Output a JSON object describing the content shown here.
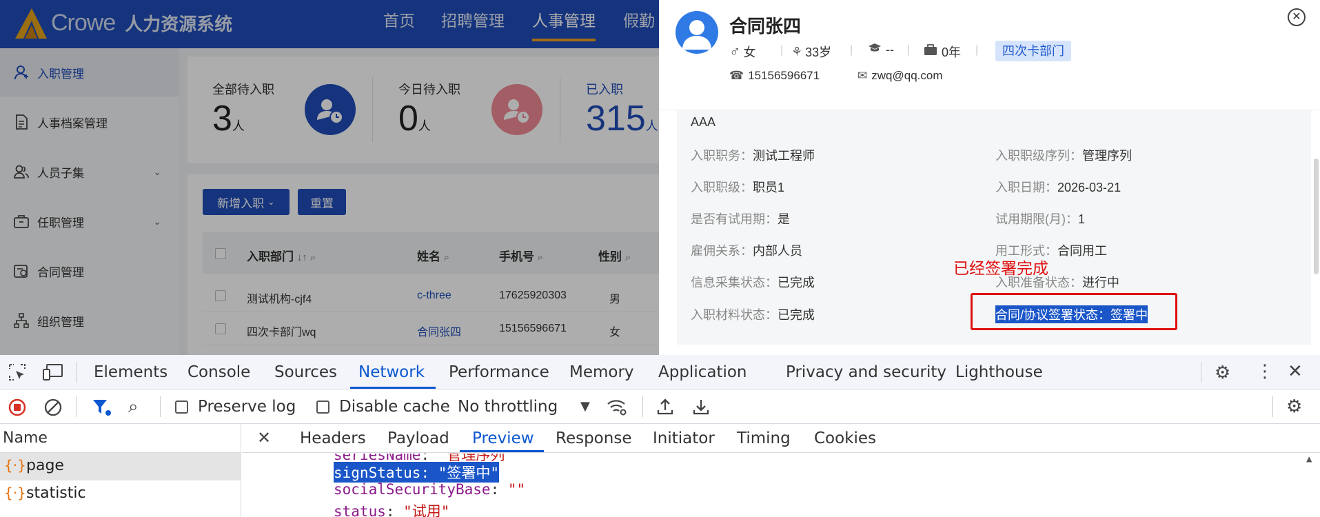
{
  "app": {
    "brand": "Crowe",
    "system_name": "人力资源系统",
    "nav": [
      "首页",
      "招聘管理",
      "人事管理",
      "假勤"
    ],
    "sidebar": [
      {
        "label": "入职管理"
      },
      {
        "label": "人事档案管理"
      },
      {
        "label": "人员子集"
      },
      {
        "label": "任职管理"
      },
      {
        "label": "合同管理"
      },
      {
        "label": "组织管理"
      }
    ],
    "stats": [
      {
        "label": "全部待入职",
        "value": "3",
        "unit": "人"
      },
      {
        "label": "今日待入职",
        "value": "0",
        "unit": "人"
      },
      {
        "label": "已入职",
        "value": "315",
        "unit": "人"
      }
    ],
    "buttons": {
      "add": "新增入职",
      "reset": "重置"
    },
    "table": {
      "headers": [
        "入职部门",
        "姓名",
        "手机号",
        "性别"
      ],
      "rows": [
        [
          "测试机构-cjf4",
          "c-three",
          "17625920303",
          "男"
        ],
        [
          "四次卡部门wq",
          "合同张四",
          "15156596671",
          "女"
        ]
      ]
    }
  },
  "drawer": {
    "name": "合同张四",
    "gender": "女",
    "age": "33岁",
    "education": "--",
    "years": "0年",
    "department": "四次卡部门",
    "phone": "15156596671",
    "email": "zwq@qq.com",
    "partial_top": "AAA",
    "fields": [
      {
        "label": "入职职务：",
        "value": "测试工程师"
      },
      {
        "label": "入职职级序列：",
        "value": "管理序列"
      },
      {
        "label": "入职职级：",
        "value": "职员1"
      },
      {
        "label": "入职日期：",
        "value": "2026-03-21"
      },
      {
        "label": "是否有试用期：",
        "value": "是"
      },
      {
        "label": "试用期限(月)：",
        "value": "1"
      },
      {
        "label": "雇佣关系：",
        "value": "内部人员"
      },
      {
        "label": "用工形式：",
        "value": "合同用工"
      },
      {
        "label": "信息采集状态：",
        "value": "已完成"
      },
      {
        "label": "入职准备状态：",
        "value": "进行中"
      },
      {
        "label": "入职材料状态：",
        "value": "已完成"
      },
      {
        "label": "合同/协议签署状态：",
        "value": "签署中"
      }
    ],
    "annotation": "已经签署完成"
  },
  "devtools": {
    "tabs": [
      "Elements",
      "Console",
      "Sources",
      "Network",
      "Performance",
      "Memory",
      "Application",
      "Privacy and security",
      "Lighthouse"
    ],
    "toolbar": {
      "preserve_log": "Preserve log",
      "disable_cache": "Disable cache",
      "throttling": "No throttling"
    },
    "name_header": "Name",
    "requests": [
      "page",
      "statistic"
    ],
    "detail_tabs": [
      "Headers",
      "Payload",
      "Preview",
      "Response",
      "Initiator",
      "Timing",
      "Cookies"
    ],
    "preview": [
      {
        "key": "seriesName",
        "value": "\"管理序列\""
      },
      {
        "key": "signStatus",
        "value": "\"签署中\""
      },
      {
        "key": "socialSecurityBase",
        "value": "\"\""
      },
      {
        "key": "status",
        "value": "\"试用\""
      }
    ]
  },
  "colors": {
    "primary": "#1f4db8",
    "highlight": "#1a56c8",
    "annotation": "#e01010",
    "devtools_active": "#0b57d0"
  }
}
